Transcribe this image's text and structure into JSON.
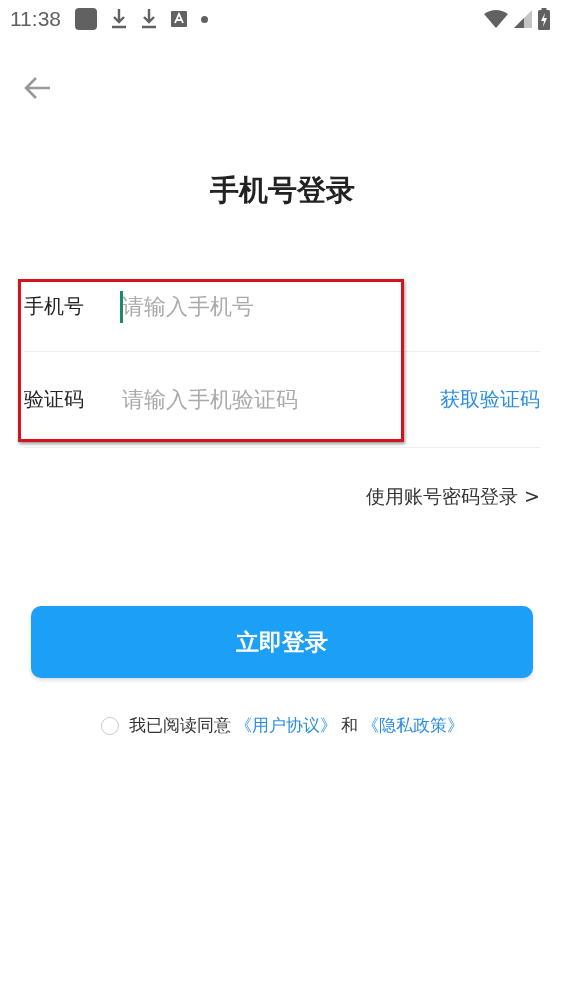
{
  "status_bar": {
    "time": "11:38"
  },
  "title": "手机号登录",
  "fields": [
    {
      "label": "手机号",
      "placeholder": "请输入手机号",
      "focused": true
    },
    {
      "label": "验证码",
      "placeholder": "请输入手机验证码",
      "focused": false,
      "action": "获取验证码"
    }
  ],
  "alt_login": "使用账号密码登录 >",
  "login_button": "立即登录",
  "agreement": {
    "checked": false,
    "text": "我已阅读同意",
    "link_1": "《用户协议》",
    "joiner": "和",
    "link_2": "《隐私政策》"
  }
}
